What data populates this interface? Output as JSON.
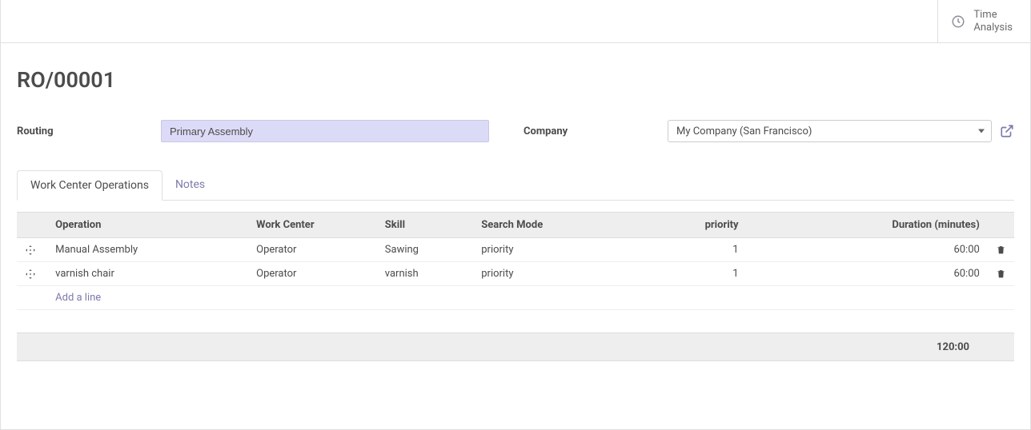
{
  "header": {
    "time_analysis_label": "Time\nAnalysis"
  },
  "record": {
    "title": "RO/00001",
    "routing_label": "Routing",
    "routing_value": "Primary Assembly",
    "company_label": "Company",
    "company_value": "My Company (San Francisco)"
  },
  "tabs": {
    "work_center_ops": "Work Center Operations",
    "notes": "Notes"
  },
  "table": {
    "headers": {
      "operation": "Operation",
      "work_center": "Work Center",
      "skill": "Skill",
      "search_mode": "Search Mode",
      "priority": "priority",
      "duration": "Duration (minutes)"
    },
    "rows": [
      {
        "operation": "Manual Assembly",
        "work_center": "Operator",
        "skill": "Sawing",
        "search_mode": "priority",
        "priority": "1",
        "duration": "60:00"
      },
      {
        "operation": "varnish chair",
        "work_center": "Operator",
        "skill": "varnish",
        "search_mode": "priority",
        "priority": "1",
        "duration": "60:00"
      }
    ],
    "add_line_label": "Add a line",
    "total_duration": "120:00"
  }
}
